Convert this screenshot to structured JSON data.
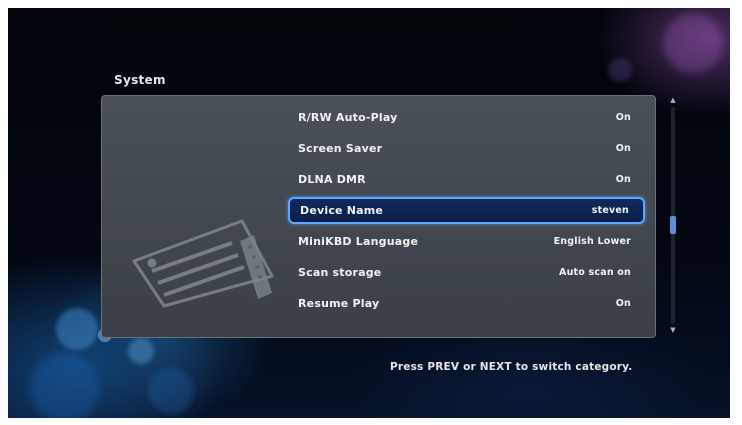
{
  "screen": {
    "category_title": "System",
    "hint_text": "Press PREV or NEXT to switch category."
  },
  "settings": [
    {
      "label": "R/RW Auto-Play",
      "value": "On"
    },
    {
      "label": "Screen Saver",
      "value": "On"
    },
    {
      "label": "DLNA DMR",
      "value": "On"
    },
    {
      "label": "Device Name",
      "value": "steven"
    },
    {
      "label": "MiniKBD Language",
      "value": "English Lower"
    },
    {
      "label": "Scan storage",
      "value": "Auto scan on"
    },
    {
      "label": "Resume Play",
      "value": "On"
    }
  ],
  "selected_setting": "Device Name",
  "scrollbar": {
    "position_fraction": 0.55
  },
  "colors": {
    "highlight_border": "#5aa8ff",
    "highlight_fill": "#0f2a5c",
    "panel": "#44494f",
    "text": "#f2f2f2"
  },
  "icons": {
    "category_illustration": "media-player-remote-icon",
    "scroll_up": "scroll-up-arrow-icon",
    "scroll_down": "scroll-down-arrow-icon"
  }
}
